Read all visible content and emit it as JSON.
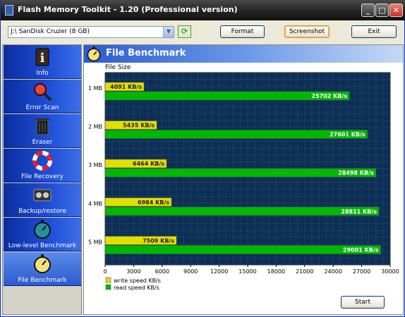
{
  "window": {
    "title": "Flash Memory Toolkit - 1.20 (Professional version)",
    "minimize": "_",
    "maximize": "□",
    "close": "✕"
  },
  "toolbar": {
    "drive": "J:\\ SanDisk Cruzer (8 GB)",
    "format_label": "Format",
    "screenshot_label": "Screenshot",
    "exit_label": "Exit"
  },
  "sidebar": {
    "items": [
      {
        "label": "Info",
        "icon": "info-icon"
      },
      {
        "label": "Error Scan",
        "icon": "magnifier-icon"
      },
      {
        "label": "Eraser",
        "icon": "trash-icon"
      },
      {
        "label": "File Recovery",
        "icon": "lifebuoy-icon"
      },
      {
        "label": "Backup/restore",
        "icon": "tape-icon"
      },
      {
        "label": "Low-level Benchmark",
        "icon": "stopwatch-icon"
      },
      {
        "label": "File Benchmark",
        "icon": "stopwatch-yellow-icon"
      }
    ],
    "selected": "File Benchmark"
  },
  "main": {
    "title": "File Benchmark",
    "start_label": "Start"
  },
  "colors": {
    "write": "#e0e000",
    "read": "#00b800",
    "plot_bg": "#0e2f55"
  },
  "chart_data": {
    "type": "bar",
    "orientation": "horizontal",
    "ylabel": "File Size",
    "categories": [
      "1 MB",
      "2 MB",
      "3 MB",
      "4 MB",
      "5 MB"
    ],
    "series": [
      {
        "name": "write speed KB/s",
        "values": [
          4091,
          5435,
          6464,
          6984,
          7509
        ],
        "labels": [
          "4091 KB/s",
          "5435 KB/s",
          "6464 KB/s",
          "6984 KB/s",
          "7509 KB/s"
        ]
      },
      {
        "name": "read speed KB/s",
        "values": [
          25702,
          27601,
          28498,
          28811,
          29001
        ],
        "labels": [
          "25702 KB/s",
          "27601 KB/s",
          "28498 KB/s",
          "28811 KB/s",
          "29001 KB/s"
        ]
      }
    ],
    "xticks": [
      "0",
      "3000",
      "6000",
      "9000",
      "12000",
      "15000",
      "18000",
      "21000",
      "24000",
      "27000",
      "30000"
    ],
    "xlim": [
      0,
      30000
    ],
    "grid": true,
    "legend": "bottom-left"
  }
}
